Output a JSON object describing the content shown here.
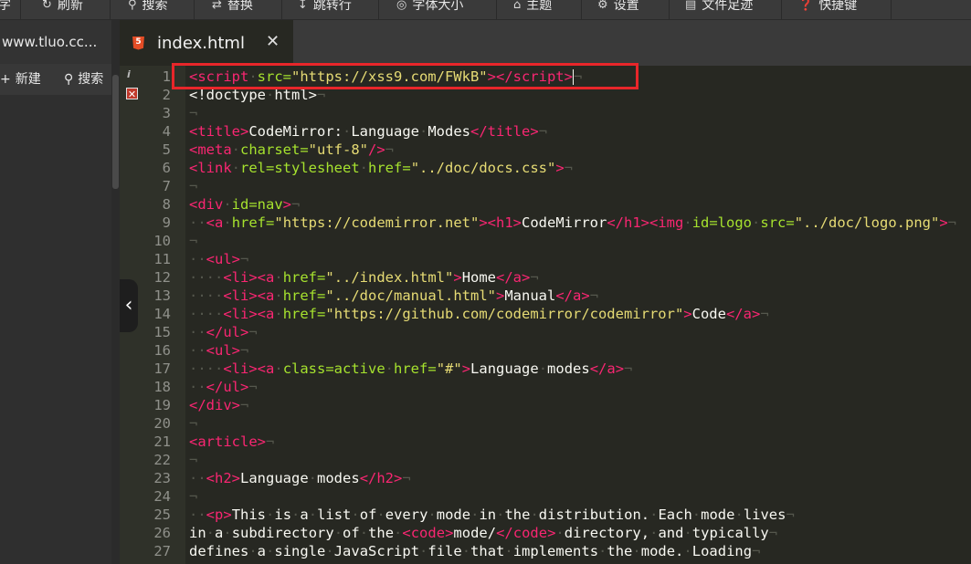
{
  "toolbar": {
    "items": [
      {
        "icon": "menu-icon",
        "label": "字"
      },
      {
        "icon": "refresh-icon",
        "label": "刷新"
      },
      {
        "icon": "search-icon",
        "label": "搜索"
      },
      {
        "icon": "replace-icon",
        "label": "替换"
      },
      {
        "icon": "goto-line-icon",
        "label": "跳转行"
      },
      {
        "icon": "font-size-icon",
        "label": "字体大小"
      },
      {
        "icon": "theme-icon",
        "label": "主题"
      },
      {
        "icon": "gear-icon",
        "label": "设置"
      },
      {
        "icon": "file-trace-icon",
        "label": "文件足迹"
      },
      {
        "icon": "help-icon",
        "label": "快捷键"
      }
    ]
  },
  "sidebar": {
    "tab_label": "www.tluo.cc...",
    "new_label": "新建",
    "search_label": "搜索"
  },
  "tab": {
    "title": "index.html",
    "close": "✕",
    "icon_text": "5"
  },
  "editor": {
    "gutter_marks": {
      "info": "i",
      "error": "✕"
    },
    "lines": [
      [
        [
          "tag",
          "<script"
        ],
        [
          "ws",
          "·"
        ],
        [
          "attr",
          "src="
        ],
        [
          "str",
          "\"https://xss9.com/FWkB\""
        ],
        [
          "tag",
          ">"
        ],
        [
          "tag",
          "</script"
        ],
        [
          "tag",
          ">"
        ]
      ],
      [
        [
          "txt",
          "<!doctype"
        ],
        [
          "ws",
          "·"
        ],
        [
          "txt",
          "html>"
        ]
      ],
      [],
      [
        [
          "tag",
          "<title"
        ],
        [
          "tag",
          ">"
        ],
        [
          "txt",
          "CodeMirror:"
        ],
        [
          "ws",
          "·"
        ],
        [
          "txt",
          "Language"
        ],
        [
          "ws",
          "·"
        ],
        [
          "txt",
          "Modes"
        ],
        [
          "tag",
          "</title"
        ],
        [
          "tag",
          ">"
        ]
      ],
      [
        [
          "tag",
          "<meta"
        ],
        [
          "ws",
          "·"
        ],
        [
          "attr",
          "charset="
        ],
        [
          "str",
          "\"utf-8\""
        ],
        [
          "tag",
          "/>"
        ]
      ],
      [
        [
          "tag",
          "<link"
        ],
        [
          "ws",
          "·"
        ],
        [
          "attr",
          "rel=stylesheet"
        ],
        [
          "ws",
          "·"
        ],
        [
          "attr",
          "href="
        ],
        [
          "str",
          "\"../doc/docs.css\""
        ],
        [
          "tag",
          ">"
        ]
      ],
      [],
      [
        [
          "tag",
          "<div"
        ],
        [
          "ws",
          "·"
        ],
        [
          "attr",
          "id=nav"
        ],
        [
          "tag",
          ">"
        ]
      ],
      [
        [
          "ws",
          "··"
        ],
        [
          "tag",
          "<a"
        ],
        [
          "ws",
          "·"
        ],
        [
          "attr",
          "href="
        ],
        [
          "str",
          "\"https://codemirror.net\""
        ],
        [
          "tag",
          ">"
        ],
        [
          "tag",
          "<h1"
        ],
        [
          "tag",
          ">"
        ],
        [
          "txt",
          "CodeMirror"
        ],
        [
          "tag",
          "</h1"
        ],
        [
          "tag",
          ">"
        ],
        [
          "tag",
          "<img"
        ],
        [
          "ws",
          "·"
        ],
        [
          "attr",
          "id=logo"
        ],
        [
          "ws",
          "·"
        ],
        [
          "attr",
          "src="
        ],
        [
          "str",
          "\"../doc/logo.png\""
        ],
        [
          "tag",
          ">"
        ]
      ],
      [],
      [
        [
          "ws",
          "··"
        ],
        [
          "tag",
          "<ul"
        ],
        [
          "tag",
          ">"
        ]
      ],
      [
        [
          "ws",
          "····"
        ],
        [
          "tag",
          "<li"
        ],
        [
          "tag",
          ">"
        ],
        [
          "tag",
          "<a"
        ],
        [
          "ws",
          "·"
        ],
        [
          "attr",
          "href="
        ],
        [
          "str",
          "\"../index.html\""
        ],
        [
          "tag",
          ">"
        ],
        [
          "txt",
          "Home"
        ],
        [
          "tag",
          "</a"
        ],
        [
          "tag",
          ">"
        ]
      ],
      [
        [
          "ws",
          "····"
        ],
        [
          "tag",
          "<li"
        ],
        [
          "tag",
          ">"
        ],
        [
          "tag",
          "<a"
        ],
        [
          "ws",
          "·"
        ],
        [
          "attr",
          "href="
        ],
        [
          "str",
          "\"../doc/manual.html\""
        ],
        [
          "tag",
          ">"
        ],
        [
          "txt",
          "Manual"
        ],
        [
          "tag",
          "</a"
        ],
        [
          "tag",
          ">"
        ]
      ],
      [
        [
          "ws",
          "····"
        ],
        [
          "tag",
          "<li"
        ],
        [
          "tag",
          ">"
        ],
        [
          "tag",
          "<a"
        ],
        [
          "ws",
          "·"
        ],
        [
          "attr",
          "href="
        ],
        [
          "str",
          "\"https://github.com/codemirror/codemirror\""
        ],
        [
          "tag",
          ">"
        ],
        [
          "txt",
          "Code"
        ],
        [
          "tag",
          "</a"
        ],
        [
          "tag",
          ">"
        ]
      ],
      [
        [
          "ws",
          "··"
        ],
        [
          "tag",
          "</ul"
        ],
        [
          "tag",
          ">"
        ]
      ],
      [
        [
          "ws",
          "··"
        ],
        [
          "tag",
          "<ul"
        ],
        [
          "tag",
          ">"
        ]
      ],
      [
        [
          "ws",
          "····"
        ],
        [
          "tag",
          "<li"
        ],
        [
          "tag",
          ">"
        ],
        [
          "tag",
          "<a"
        ],
        [
          "ws",
          "·"
        ],
        [
          "attr",
          "class=active"
        ],
        [
          "ws",
          "·"
        ],
        [
          "attr",
          "href="
        ],
        [
          "str",
          "\"#\""
        ],
        [
          "tag",
          ">"
        ],
        [
          "txt",
          "Language"
        ],
        [
          "ws",
          "·"
        ],
        [
          "txt",
          "modes"
        ],
        [
          "tag",
          "</a"
        ],
        [
          "tag",
          ">"
        ]
      ],
      [
        [
          "ws",
          "··"
        ],
        [
          "tag",
          "</ul"
        ],
        [
          "tag",
          ">"
        ]
      ],
      [
        [
          "tag",
          "</div"
        ],
        [
          "tag",
          ">"
        ]
      ],
      [],
      [
        [
          "tag",
          "<article"
        ],
        [
          "tag",
          ">"
        ]
      ],
      [],
      [
        [
          "ws",
          "··"
        ],
        [
          "tag",
          "<h2"
        ],
        [
          "tag",
          ">"
        ],
        [
          "txt",
          "Language"
        ],
        [
          "ws",
          "·"
        ],
        [
          "txt",
          "modes"
        ],
        [
          "tag",
          "</h2"
        ],
        [
          "tag",
          ">"
        ]
      ],
      [],
      [
        [
          "ws",
          "··"
        ],
        [
          "tag",
          "<p"
        ],
        [
          "tag",
          ">"
        ],
        [
          "txt",
          "This"
        ],
        [
          "ws",
          "·"
        ],
        [
          "txt",
          "is"
        ],
        [
          "ws",
          "·"
        ],
        [
          "txt",
          "a"
        ],
        [
          "ws",
          "·"
        ],
        [
          "txt",
          "list"
        ],
        [
          "ws",
          "·"
        ],
        [
          "txt",
          "of"
        ],
        [
          "ws",
          "·"
        ],
        [
          "txt",
          "every"
        ],
        [
          "ws",
          "·"
        ],
        [
          "txt",
          "mode"
        ],
        [
          "ws",
          "·"
        ],
        [
          "txt",
          "in"
        ],
        [
          "ws",
          "·"
        ],
        [
          "txt",
          "the"
        ],
        [
          "ws",
          "·"
        ],
        [
          "txt",
          "distribution."
        ],
        [
          "ws",
          "·"
        ],
        [
          "txt",
          "Each"
        ],
        [
          "ws",
          "·"
        ],
        [
          "txt",
          "mode"
        ],
        [
          "ws",
          "·"
        ],
        [
          "txt",
          "lives"
        ]
      ],
      [
        [
          "txt",
          "in"
        ],
        [
          "ws",
          "·"
        ],
        [
          "txt",
          "a"
        ],
        [
          "ws",
          "·"
        ],
        [
          "txt",
          "subdirectory"
        ],
        [
          "ws",
          "·"
        ],
        [
          "txt",
          "of"
        ],
        [
          "ws",
          "·"
        ],
        [
          "txt",
          "the"
        ],
        [
          "ws",
          "·"
        ],
        [
          "tag",
          "<code"
        ],
        [
          "tag",
          ">"
        ],
        [
          "txt",
          "mode/"
        ],
        [
          "tag",
          "</code"
        ],
        [
          "tag",
          ">"
        ],
        [
          "ws",
          "·"
        ],
        [
          "txt",
          "directory,"
        ],
        [
          "ws",
          "·"
        ],
        [
          "txt",
          "and"
        ],
        [
          "ws",
          "·"
        ],
        [
          "txt",
          "typically"
        ]
      ],
      [
        [
          "txt",
          "defines"
        ],
        [
          "ws",
          "·"
        ],
        [
          "txt",
          "a"
        ],
        [
          "ws",
          "·"
        ],
        [
          "txt",
          "single"
        ],
        [
          "ws",
          "·"
        ],
        [
          "txt",
          "JavaScript"
        ],
        [
          "ws",
          "·"
        ],
        [
          "txt",
          "file"
        ],
        [
          "ws",
          "·"
        ],
        [
          "txt",
          "that"
        ],
        [
          "ws",
          "·"
        ],
        [
          "txt",
          "implements"
        ],
        [
          "ws",
          "·"
        ],
        [
          "txt",
          "the"
        ],
        [
          "ws",
          "·"
        ],
        [
          "txt",
          "mode."
        ],
        [
          "ws",
          "·"
        ],
        [
          "txt",
          "Loading"
        ]
      ]
    ],
    "eol_char": "¬"
  }
}
